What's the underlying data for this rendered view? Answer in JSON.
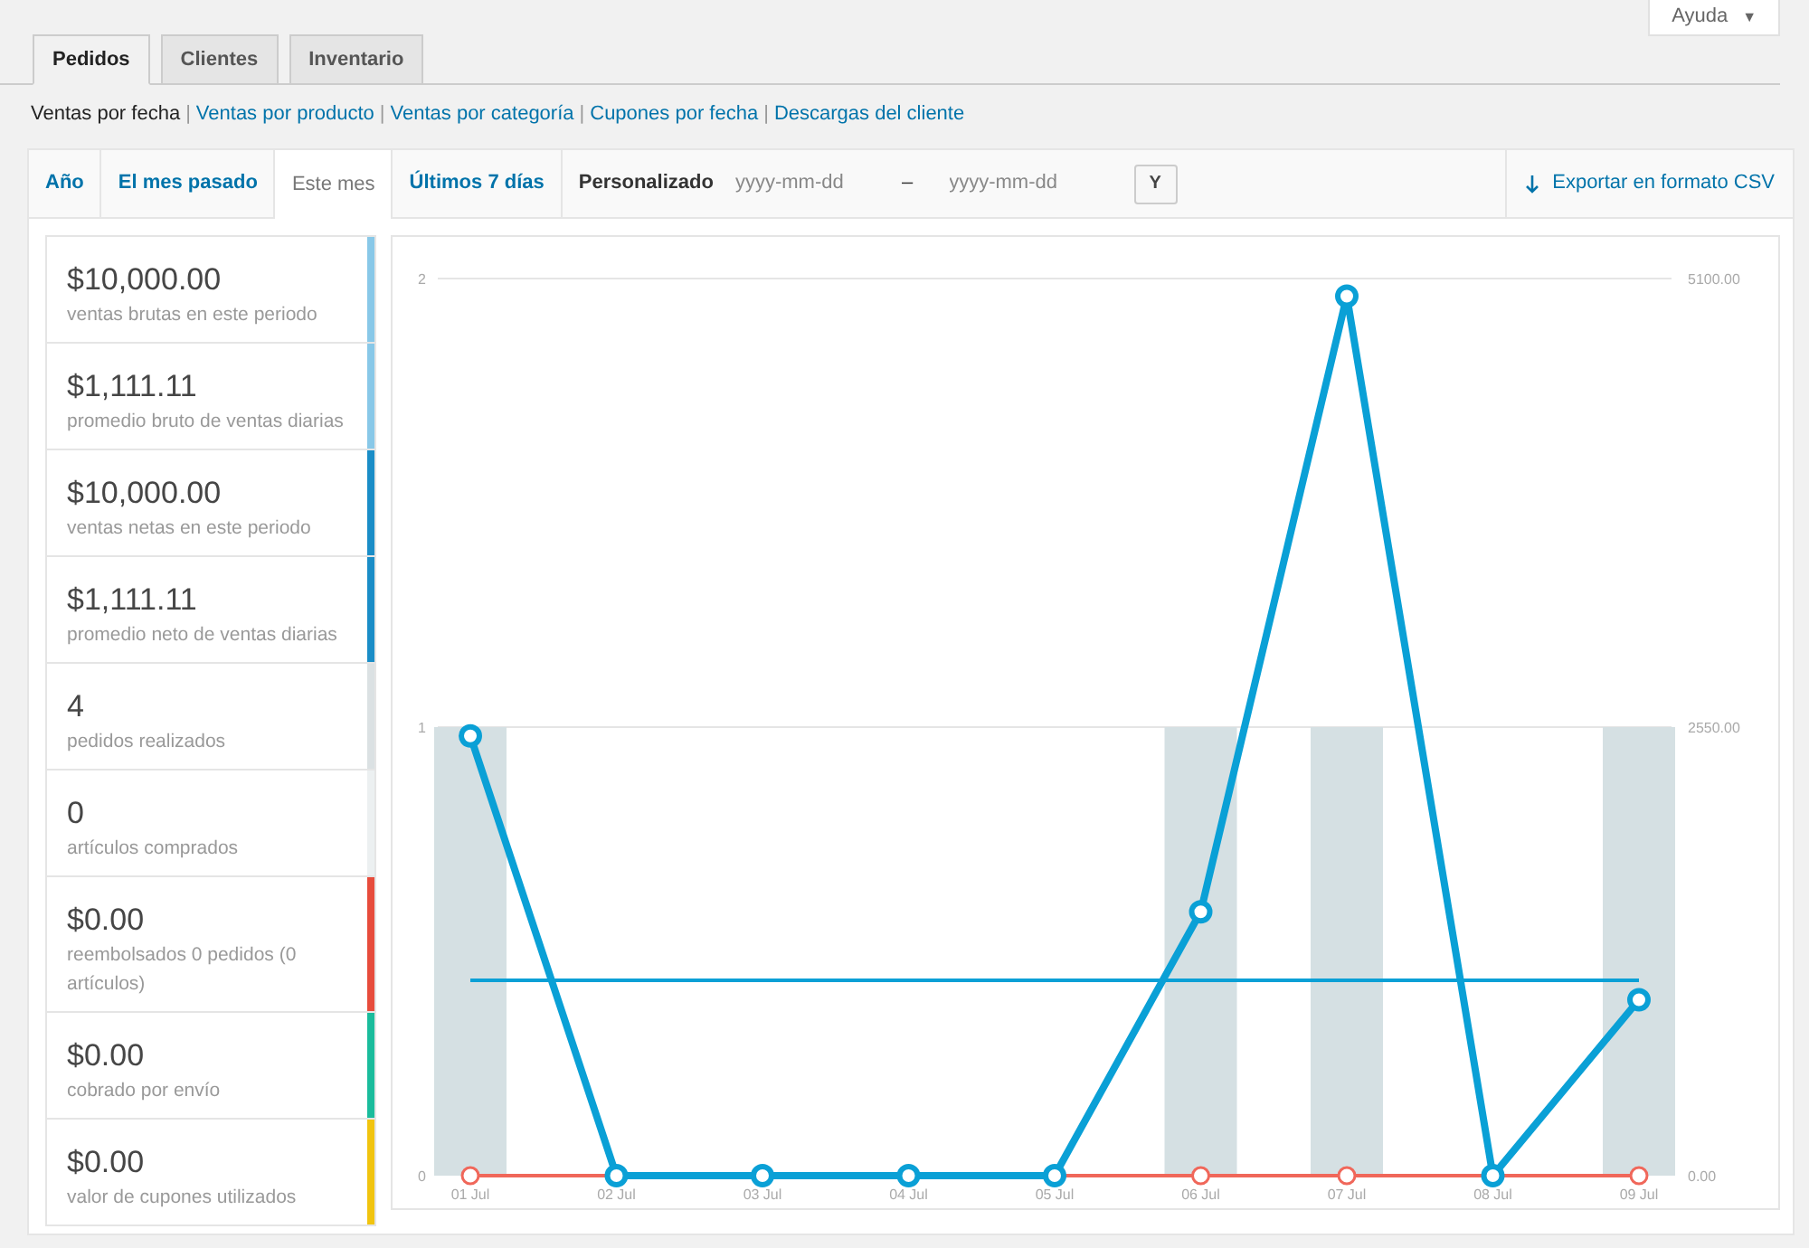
{
  "help_button": {
    "label": "Ayuda",
    "caret": "▼"
  },
  "tabs": [
    {
      "label": "Pedidos",
      "selected": true
    },
    {
      "label": "Clientes",
      "selected": false
    },
    {
      "label": "Inventario",
      "selected": false
    }
  ],
  "report_links": [
    {
      "label": "Ventas por fecha",
      "selected": true
    },
    {
      "label": "Ventas por producto",
      "selected": false
    },
    {
      "label": "Ventas por categoría",
      "selected": false
    },
    {
      "label": "Cupones por fecha",
      "selected": false
    },
    {
      "label": "Descargas del cliente",
      "selected": false
    }
  ],
  "separator": "|",
  "range_tabs": [
    {
      "label": "Año",
      "selected": false
    },
    {
      "label": "El mes pasado",
      "selected": false
    },
    {
      "label": "Este mes",
      "selected": true
    },
    {
      "label": "Últimos 7 días",
      "selected": false
    }
  ],
  "custom_range": {
    "label": "Personalizado",
    "start_placeholder": "yyyy-mm-dd",
    "dash": "–",
    "end_placeholder": "yyyy-mm-dd",
    "button": "Y"
  },
  "export_link": "Exportar en formato CSV",
  "legend": [
    {
      "value": "$10,000.00",
      "label": "ventas brutas en este periodo",
      "color": "#88c8e8"
    },
    {
      "value": "$1,111.11",
      "label": "promedio bruto de ventas diarias",
      "color": "#88c8e8"
    },
    {
      "value": "$10,000.00",
      "label": "ventas netas en este periodo",
      "color": "#1a8dc7"
    },
    {
      "value": "$1,111.11",
      "label": "promedio neto de ventas diarias",
      "color": "#1a8dc7"
    },
    {
      "value": "4",
      "label": "pedidos realizados",
      "color": "#dbe1e3"
    },
    {
      "value": "0",
      "label": "artículos comprados",
      "color": "#ecf0f1"
    },
    {
      "value": "$0.00",
      "label": "reembolsados 0 pedidos (0 artículos)",
      "color": "#e74c3c"
    },
    {
      "value": "$0.00",
      "label": "cobrado por envío",
      "color": "#1abc9c"
    },
    {
      "value": "$0.00",
      "label": "valor de cupones utilizados",
      "color": "#f1c40f"
    }
  ],
  "chart_data": {
    "type": "bar",
    "categories": [
      "01 Jul",
      "02 Jul",
      "03 Jul",
      "04 Jul",
      "05 Jul",
      "06 Jul",
      "07 Jul",
      "08 Jul",
      "09 Jul"
    ],
    "ylim": [
      0,
      2
    ],
    "yticks": [
      0,
      1,
      2
    ],
    "y2lim": [
      0,
      5100
    ],
    "y2ticks": [
      {
        "value": 0,
        "label": "0.00"
      },
      {
        "value": 2550,
        "label": "2550.00"
      },
      {
        "value": 5100,
        "label": "5100.00"
      }
    ],
    "ref_lines": [
      {
        "value": 1111.11,
        "axis": "y2",
        "color": "#0aa0d6"
      }
    ],
    "series": [
      {
        "color": "#d5e0e3",
        "values": [
          1,
          0,
          0,
          0,
          0,
          1,
          1,
          0,
          1
        ]
      },
      {
        "type": "line",
        "marker": true,
        "axis": "y2",
        "color": "#f0675a",
        "values": [
          0,
          0,
          0,
          0,
          0,
          0,
          0,
          0,
          0
        ]
      },
      {
        "type": "line",
        "marker": true,
        "axis": "y2",
        "color": "#0aa0d6",
        "values": [
          2500,
          0,
          0,
          0,
          0,
          1500,
          5000,
          0,
          1000
        ]
      }
    ]
  }
}
